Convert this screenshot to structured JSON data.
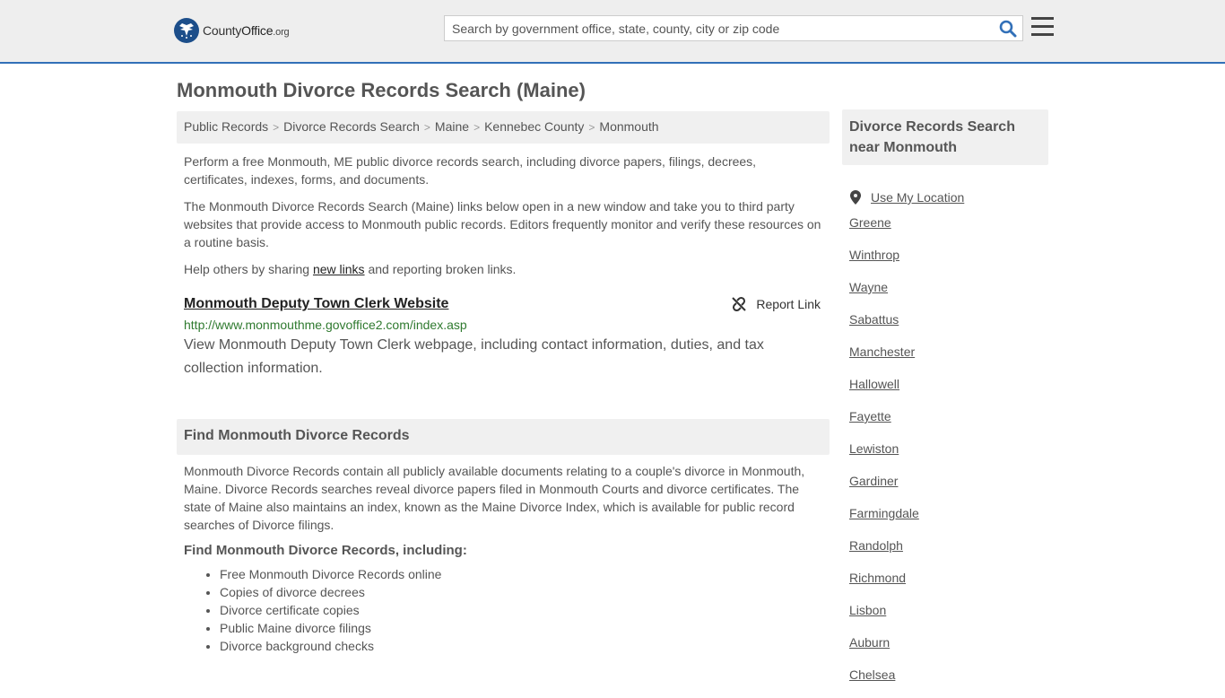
{
  "header": {
    "logo": {
      "name_part1": "County",
      "name_part2": "Office",
      "tld": ".org"
    },
    "search": {
      "placeholder": "Search by government office, state, county, city or zip code"
    }
  },
  "page_title": "Monmouth Divorce Records Search (Maine)",
  "breadcrumb": [
    "Public Records",
    "Divorce Records Search",
    "Maine",
    "Kennebec County",
    "Monmouth"
  ],
  "intro": {
    "p1": "Perform a free Monmouth, ME public divorce records search, including divorce papers, filings, decrees, certificates, indexes, forms, and documents.",
    "p2": "The Monmouth Divorce Records Search (Maine) links below open in a new window and take you to third party websites that provide access to Monmouth public records. Editors frequently monitor and verify these resources on a routine basis.",
    "p3_before": "Help others by sharing ",
    "p3_link": "new links",
    "p3_after": " and reporting broken links."
  },
  "listing": {
    "title": "Monmouth Deputy Town Clerk Website",
    "report_label": "Report Link",
    "url": "http://www.monmouthme.govoffice2.com/index.asp",
    "description": "View Monmouth Deputy Town Clerk webpage, including contact information, duties, and tax collection information."
  },
  "find_section": {
    "heading": "Find Monmouth Divorce Records",
    "body": "Monmouth Divorce Records contain all publicly available documents relating to a couple's divorce in Monmouth, Maine. Divorce Records searches reveal divorce papers filed in Monmouth Courts and divorce certificates. The state of Maine also maintains an index, known as the Maine Divorce Index, which is available for public record searches of Divorce filings.",
    "subheading": "Find Monmouth Divorce Records, including:",
    "items": [
      "Free Monmouth Divorce Records online",
      "Copies of divorce decrees",
      "Divorce certificate copies",
      "Public Maine divorce filings",
      "Divorce background checks"
    ]
  },
  "sidebar": {
    "heading": "Divorce Records Search near Monmouth",
    "use_location": "Use My Location",
    "cities": [
      "Greene",
      "Winthrop",
      "Wayne",
      "Sabattus",
      "Manchester",
      "Hallowell",
      "Fayette",
      "Lewiston",
      "Gardiner",
      "Farmingdale",
      "Randolph",
      "Richmond",
      "Lisbon",
      "Auburn",
      "Chelsea"
    ]
  },
  "colors": {
    "accent_blue": "#3270b8",
    "url_green": "#2f7a2f",
    "panel_gray": "#f0f0f0"
  }
}
